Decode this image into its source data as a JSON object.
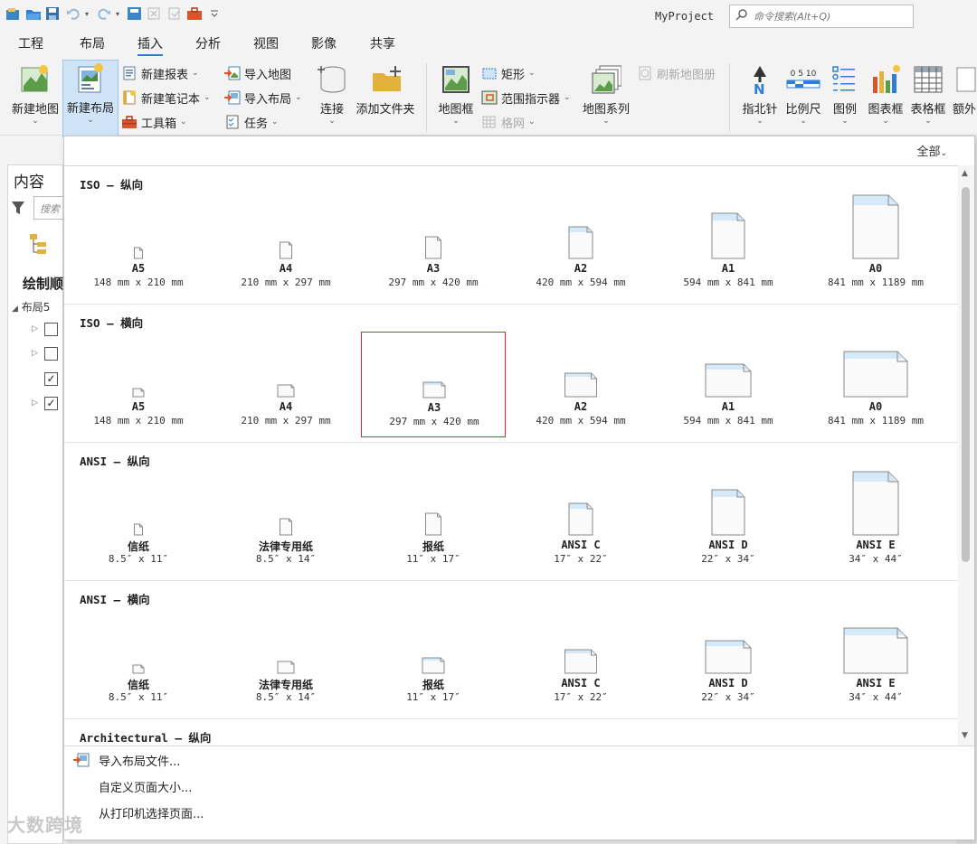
{
  "title_bar": {
    "project": "MyProject",
    "search_placeholder": "命令搜索(Alt+Q)"
  },
  "tabs": [
    {
      "label": "工程"
    },
    {
      "label": "布局"
    },
    {
      "label": "插入"
    },
    {
      "label": "分析"
    },
    {
      "label": "视图"
    },
    {
      "label": "影像"
    },
    {
      "label": "共享"
    }
  ],
  "active_tab": "插入",
  "ribbon": {
    "new_map": "新建地图",
    "new_layout": "新建布局",
    "new_report": "新建报表",
    "new_notebook": "新建笔记本",
    "toolbox": "工具箱",
    "import_map": "导入地图",
    "import_layout": "导入布局",
    "tasks": "任务",
    "connect": "连接",
    "add_folder": "添加文件夹",
    "map_frame": "地图框",
    "rectangle": "矩形",
    "extent_indicator": "范围指示器",
    "grid": "格网",
    "map_series": "地图系列",
    "refresh_map_series": "刷新地图册",
    "north_arrow": "指北针",
    "scale_bar": "比例尺",
    "scale_bar_ticks": "0  5  10",
    "legend": "图例",
    "chart_frame": "图表框",
    "table_frame": "表格框",
    "extra": "额外"
  },
  "contents_pane": {
    "title": "内容",
    "search_placeholder": "搜索",
    "drawing_order": "绘制顺",
    "layout_item": "布局5"
  },
  "dropdown": {
    "filter": "全部",
    "sections": [
      {
        "title": "ISO – 纵向",
        "orientation": "portrait",
        "items": [
          {
            "name": "A5",
            "dim": "148 mm x 210 mm"
          },
          {
            "name": "A4",
            "dim": "210 mm x 297 mm"
          },
          {
            "name": "A3",
            "dim": "297 mm x 420 mm"
          },
          {
            "name": "A2",
            "dim": "420 mm x 594 mm"
          },
          {
            "name": "A1",
            "dim": "594 mm x 841 mm"
          },
          {
            "name": "A0",
            "dim": "841 mm x 1189 mm"
          }
        ]
      },
      {
        "title": "ISO – 横向",
        "orientation": "landscape",
        "items": [
          {
            "name": "A5",
            "dim": "148 mm x 210 mm"
          },
          {
            "name": "A4",
            "dim": "210 mm x 297 mm"
          },
          {
            "name": "A3",
            "dim": "297 mm x 420 mm"
          },
          {
            "name": "A2",
            "dim": "420 mm x 594 mm"
          },
          {
            "name": "A1",
            "dim": "594 mm x 841 mm"
          },
          {
            "name": "A0",
            "dim": "841 mm x 1189 mm"
          }
        ]
      },
      {
        "title": "ANSI – 纵向",
        "orientation": "portrait",
        "items": [
          {
            "name": "信纸",
            "dim": "8.5″ x 11″"
          },
          {
            "name": "法律专用纸",
            "dim": "8.5″ x 14″"
          },
          {
            "name": "报纸",
            "dim": "11″ x 17″"
          },
          {
            "name": "ANSI C",
            "dim": "17″ x 22″"
          },
          {
            "name": "ANSI D",
            "dim": "22″ x 34″"
          },
          {
            "name": "ANSI E",
            "dim": "34″ x 44″"
          }
        ]
      },
      {
        "title": "ANSI – 横向",
        "orientation": "landscape",
        "items": [
          {
            "name": "信纸",
            "dim": "8.5″ x 11″"
          },
          {
            "name": "法律专用纸",
            "dim": "8.5″ x 14″"
          },
          {
            "name": "报纸",
            "dim": "11″ x 17″"
          },
          {
            "name": "ANSI C",
            "dim": "17″ x 22″"
          },
          {
            "name": "ANSI D",
            "dim": "22″ x 34″"
          },
          {
            "name": "ANSI E",
            "dim": "34″ x 44″"
          }
        ]
      },
      {
        "title": "Architectural – 纵向",
        "orientation": "portrait",
        "items": []
      }
    ],
    "selected": {
      "section": 1,
      "item": 2
    },
    "footer": [
      {
        "label": "导入布局文件...",
        "icon": "import-layout-icon"
      },
      {
        "label": "自定义页面大小...",
        "icon": ""
      },
      {
        "label": "从打印机选择页面...",
        "icon": ""
      }
    ]
  },
  "watermark": "大数跨境",
  "colors": {
    "accent": "#2f7fd6",
    "selection_border": "#e0262e",
    "page_header": "#d6e9f8",
    "pressed_button": "#cfe4f7"
  }
}
